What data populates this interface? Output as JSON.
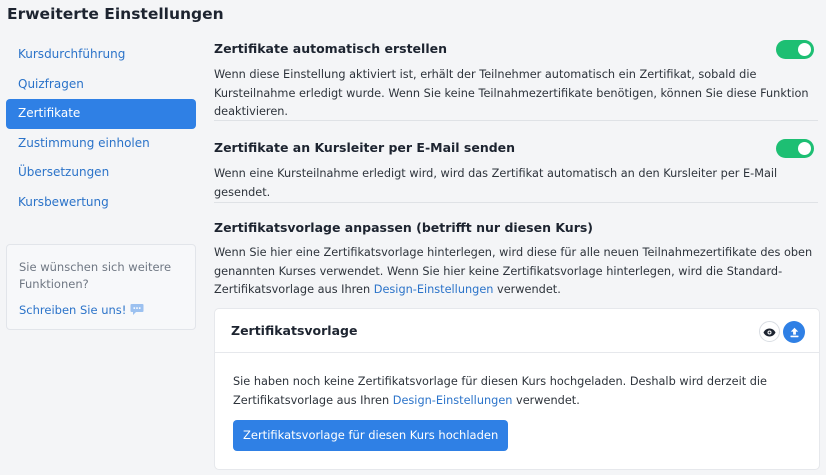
{
  "page": {
    "title": "Erweiterte Einstellungen"
  },
  "sidebar": {
    "items": [
      {
        "label": "Kursdurchführung",
        "active": false
      },
      {
        "label": "Quizfragen",
        "active": false
      },
      {
        "label": "Zertifikate",
        "active": true
      },
      {
        "label": "Zustimmung einholen",
        "active": false
      },
      {
        "label": "Übersetzungen",
        "active": false
      },
      {
        "label": "Kursbewertung",
        "active": false
      }
    ],
    "help": {
      "text": "Sie wünschen sich weitere Funktionen?",
      "link": "Schreiben Sie uns!",
      "icon": "chat-bubble-icon"
    }
  },
  "settings": {
    "auto_certificates": {
      "title": "Zertifikate automatisch erstellen",
      "description": "Wenn diese Einstellung aktiviert ist, erhält der Teilnehmer automatisch ein Zertifikat, sobald die Kursteilnahme erledigt wurde. Wenn Sie keine Teilnahmezertifikate benötigen, können Sie diese Funktion deaktivieren.",
      "enabled": true
    },
    "send_to_instructor": {
      "title": "Zertifikate an Kursleiter per E-Mail senden",
      "description": "Wenn eine Kursteilnahme erledigt wird, wird das Zertifikat automatisch an den Kursleiter per E-Mail gesendet.",
      "enabled": true
    },
    "template": {
      "title": "Zertifikatsvorlage anpassen (betrifft nur diesen Kurs)",
      "description_before": "Wenn Sie hier eine Zertifikatsvorlage hinterlegen, wird diese für alle neuen Teilnahmezertifikate des oben genannten Kurses verwendet. Wenn Sie hier keine Zertifikatsvorlage hinterlegen, wird die Standard-Zertifikatsvorlage aus Ihren ",
      "description_link": "Design-Einstellungen",
      "description_after": " verwendet."
    }
  },
  "template_card": {
    "title": "Zertifikatsvorlage",
    "body_before": "Sie haben noch keine Zertifikatsvorlage für diesen Kurs hochgeladen. Deshalb wird derzeit die Zertifikatsvorlage aus Ihren ",
    "body_link": "Design-Einstellungen",
    "body_after": " verwendet.",
    "upload_button": "Zertifikatsvorlage für diesen Kurs hochladen",
    "icons": {
      "preview": "eye-icon",
      "upload": "upload-icon"
    }
  },
  "colors": {
    "accent": "#2f80e5",
    "link": "#2b73c9",
    "toggle_on": "#1dbf73",
    "background": "#f4f5f7"
  }
}
